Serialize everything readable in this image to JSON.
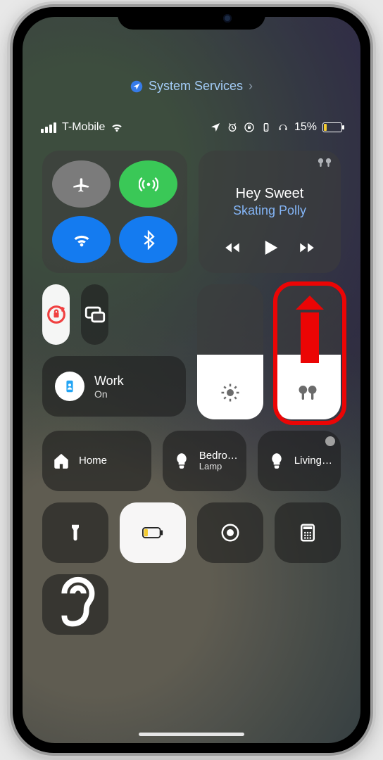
{
  "breadcrumb": {
    "icon": "location-arrow",
    "label": "System Services"
  },
  "status": {
    "carrier": "T-Mobile",
    "signal_bars": 4,
    "wifi": true,
    "indicators": [
      "location",
      "alarm",
      "rotation-lock",
      "portrait",
      "headphones"
    ],
    "battery_percent_label": "15%",
    "battery_percent": 15
  },
  "connectivity": {
    "airplane": {
      "on": false
    },
    "cellular": {
      "on": true
    },
    "wifi": {
      "on": true
    },
    "bluetooth": {
      "on": true
    }
  },
  "media": {
    "output_icon": "airpods",
    "title": "Hey Sweet",
    "artist": "Skating Polly",
    "playing": false
  },
  "orientation_lock": {
    "on": true
  },
  "screen_mirror_icon": "screen-mirror",
  "focus": {
    "label": "Work",
    "state": "On",
    "icon": "id-badge"
  },
  "brightness": {
    "percent": 48,
    "icon": "sun"
  },
  "volume": {
    "percent": 48,
    "icon": "airpods"
  },
  "home_row": {
    "home": {
      "label": "Home",
      "icon": "home"
    },
    "tile2": {
      "label": "Bedro…",
      "sub": "Lamp",
      "icon": "bulb"
    },
    "tile3": {
      "label": "Living…",
      "icon": "bulb",
      "warn": true
    }
  },
  "util_row": {
    "flashlight": "flashlight-icon",
    "low_power": "battery-low-icon",
    "record": "screen-record-icon",
    "calculator": "calculator-icon"
  },
  "hearing_icon": "ear-icon",
  "annotation": {
    "highlight": "volume-slider",
    "direction": "up"
  }
}
